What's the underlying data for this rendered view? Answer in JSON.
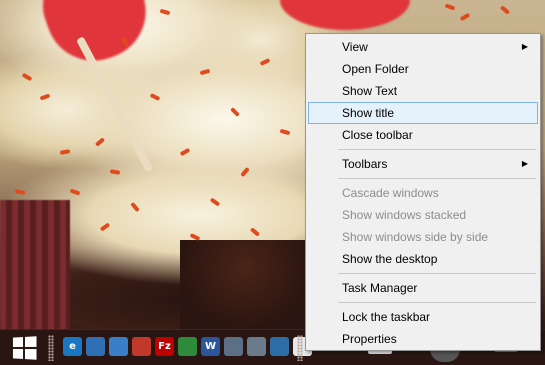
{
  "context_menu": {
    "items": [
      {
        "label": "View",
        "submenu": true
      },
      {
        "label": "Open Folder"
      },
      {
        "label": "Show Text"
      },
      {
        "label": "Show title",
        "highlighted": true
      },
      {
        "label": "Close toolbar"
      },
      {
        "label": "Toolbars",
        "submenu": true
      },
      {
        "label": "Cascade windows",
        "disabled": true
      },
      {
        "label": "Show windows stacked",
        "disabled": true
      },
      {
        "label": "Show windows side by side",
        "disabled": true
      },
      {
        "label": "Show the desktop"
      },
      {
        "label": "Task Manager"
      },
      {
        "label": "Lock the taskbar"
      },
      {
        "label": "Properties"
      }
    ],
    "submenu_arrow": "▶"
  },
  "taskbar": {
    "icons": [
      {
        "name": "internet-explorer-icon",
        "glyph": "e",
        "color": "#1a78c2"
      },
      {
        "name": "desktop-icon",
        "glyph": "",
        "color": "#2f6fb3"
      },
      {
        "name": "network-window-icon",
        "glyph": "",
        "color": "#3a7dc8"
      },
      {
        "name": "paint-icon",
        "glyph": "",
        "color": "#c0392b"
      },
      {
        "name": "filezilla-icon",
        "glyph": "Fz",
        "color": "#bf0000"
      },
      {
        "name": "globe-app-icon",
        "glyph": "",
        "color": "#2e8b3a"
      },
      {
        "name": "word-icon",
        "glyph": "W",
        "color": "#2b579a"
      },
      {
        "name": "remote-desktop-icon",
        "glyph": "",
        "color": "#5b6f86"
      },
      {
        "name": "gear-app-icon",
        "glyph": "",
        "color": "#6a7b8c"
      },
      {
        "name": "shield-app-icon",
        "glyph": "",
        "color": "#2d6ea8"
      },
      {
        "name": "calendar-app-icon",
        "glyph": "",
        "color": "#e8e8e8"
      }
    ]
  }
}
